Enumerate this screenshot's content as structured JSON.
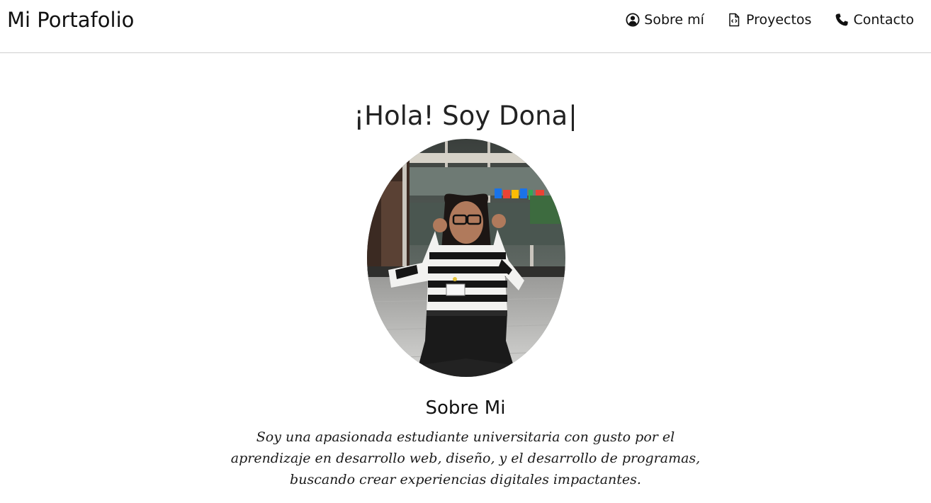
{
  "navbar": {
    "brand": "Mi Portafolio",
    "links": [
      {
        "label": "Sobre mí",
        "icon": "user-circle-icon"
      },
      {
        "label": "Proyectos",
        "icon": "code-file-icon"
      },
      {
        "label": "Contacto",
        "icon": "phone-icon"
      }
    ]
  },
  "hero": {
    "greeting": "¡Hola! Soy Dona",
    "cursor": "|",
    "photo_alt": "Dona",
    "about_title": "Sobre Mi",
    "about_text": "Soy una apasionada estudiante universitaria con gusto por el aprendizaje en desarrollo web, diseño, y el desarrollo de programas, buscando crear experiencias digitales impactantes."
  }
}
